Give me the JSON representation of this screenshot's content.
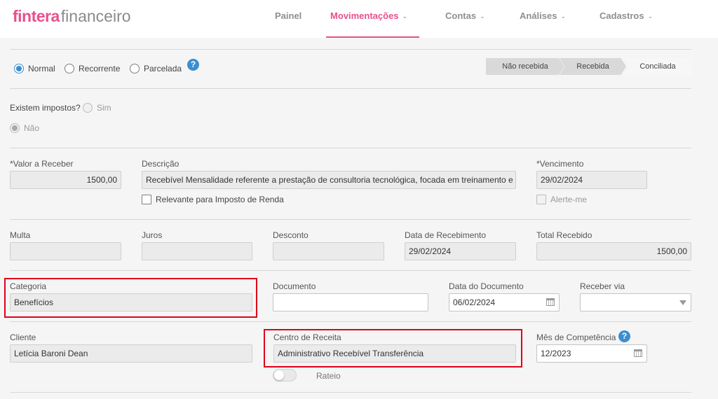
{
  "header": {
    "logo_brand": "fintera",
    "logo_suffix": "financeiro",
    "nav": [
      {
        "label": "Painel"
      },
      {
        "label": "Movimentações"
      },
      {
        "label": "Contas"
      },
      {
        "label": "Análises"
      },
      {
        "label": "Cadastros"
      }
    ],
    "active_nav": "Movimentações",
    "accent_color": "#e8508e"
  },
  "recurrence": {
    "options": [
      {
        "label": "Normal",
        "selected": true
      },
      {
        "label": "Recorrente",
        "selected": false
      },
      {
        "label": "Parcelada",
        "selected": false
      }
    ],
    "help_icon": "?"
  },
  "status_steps": [
    {
      "label": "Não recebida"
    },
    {
      "label": "Recebida"
    },
    {
      "label": "Conciliada"
    }
  ],
  "taxes": {
    "question": "Existem impostos?",
    "yes_label": "Sim",
    "no_label": "Não",
    "selected": "Não"
  },
  "form": {
    "valor": {
      "label": "*Valor a Receber",
      "value": "1500,00"
    },
    "descricao": {
      "label": "Descrição",
      "value": "Recebível Mensalidade referente a prestação de consultoria tecnológica, focada em treinamento e"
    },
    "relevante_ir": {
      "label": "Relevante para Imposto de Renda",
      "checked": false
    },
    "vencimento": {
      "label": "*Vencimento",
      "value": "29/02/2024"
    },
    "alerte": {
      "label": "Alerte-me",
      "checked": false
    },
    "multa": {
      "label": "Multa",
      "value": ""
    },
    "juros": {
      "label": "Juros",
      "value": ""
    },
    "desconto": {
      "label": "Desconto",
      "value": ""
    },
    "data_recebimento": {
      "label": "Data de Recebimento",
      "value": "29/02/2024"
    },
    "total_recebido": {
      "label": "Total Recebido",
      "value": "1500,00"
    },
    "categoria": {
      "label": "Categoria",
      "value": "Benefícios"
    },
    "documento": {
      "label": "Documento",
      "value": ""
    },
    "data_documento": {
      "label": "Data do Documento",
      "value": "06/02/2024"
    },
    "receber_via": {
      "label": "Receber via",
      "value": ""
    },
    "cliente": {
      "label": "Cliente",
      "value": "Letícia Baroni Dean"
    },
    "centro_receita": {
      "label": "Centro de Receita",
      "value": "Administrativo Recebível Transferência"
    },
    "mes_competencia": {
      "label": "Mês de Competência",
      "value": "12/2023"
    },
    "rateio": {
      "label": "Rateio",
      "on": false
    }
  },
  "colors": {
    "highlight": "#e2001a",
    "radio_selected": "#3b8ed0"
  }
}
